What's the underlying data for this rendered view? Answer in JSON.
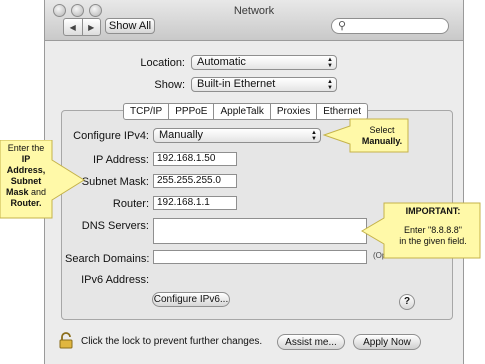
{
  "window": {
    "title": "Network"
  },
  "toolbar": {
    "show_all": "Show All",
    "back": "◀",
    "forward": "▶",
    "search_placeholder": ""
  },
  "location": {
    "label": "Location:",
    "value": "Automatic"
  },
  "show": {
    "label": "Show:",
    "value": "Built-in Ethernet"
  },
  "tabs": [
    "TCP/IP",
    "PPPoE",
    "AppleTalk",
    "Proxies",
    "Ethernet"
  ],
  "configure": {
    "label": "Configure IPv4:",
    "value": "Manually"
  },
  "ip": {
    "label": "IP Address:",
    "value": "192.168.1.50"
  },
  "mask": {
    "label": "Subnet Mask:",
    "value": "255.255.255.0"
  },
  "router": {
    "label": "Router:",
    "value": "192.168.1.1"
  },
  "dns": {
    "label": "DNS Servers:",
    "value": ""
  },
  "search_domains": {
    "label": "Search Domains:",
    "value": "",
    "hint": "(Opt"
  },
  "ipv6": {
    "label": "IPv6 Address:",
    "button": "Configure IPv6..."
  },
  "help": "?",
  "footer": {
    "lock_text": "Click the lock to prevent further changes.",
    "assist": "Assist me...",
    "apply": "Apply Now"
  },
  "callouts": {
    "left": {
      "l1": "Enter the",
      "l2": "IP",
      "l3": "Address,",
      "l4": "Subnet",
      "l5": "Mask",
      "l6": " and",
      "l7": "Router."
    },
    "top_right": {
      "l1": "Select",
      "l2": "Manually."
    },
    "bottom_right": {
      "l1": "IMPORTANT:",
      "l2": "Enter \"8.8.8.8\"",
      "l3": "in the given field."
    }
  },
  "colors": {
    "callout_fill": "#fff9a8",
    "callout_border": "#c5b34a"
  }
}
